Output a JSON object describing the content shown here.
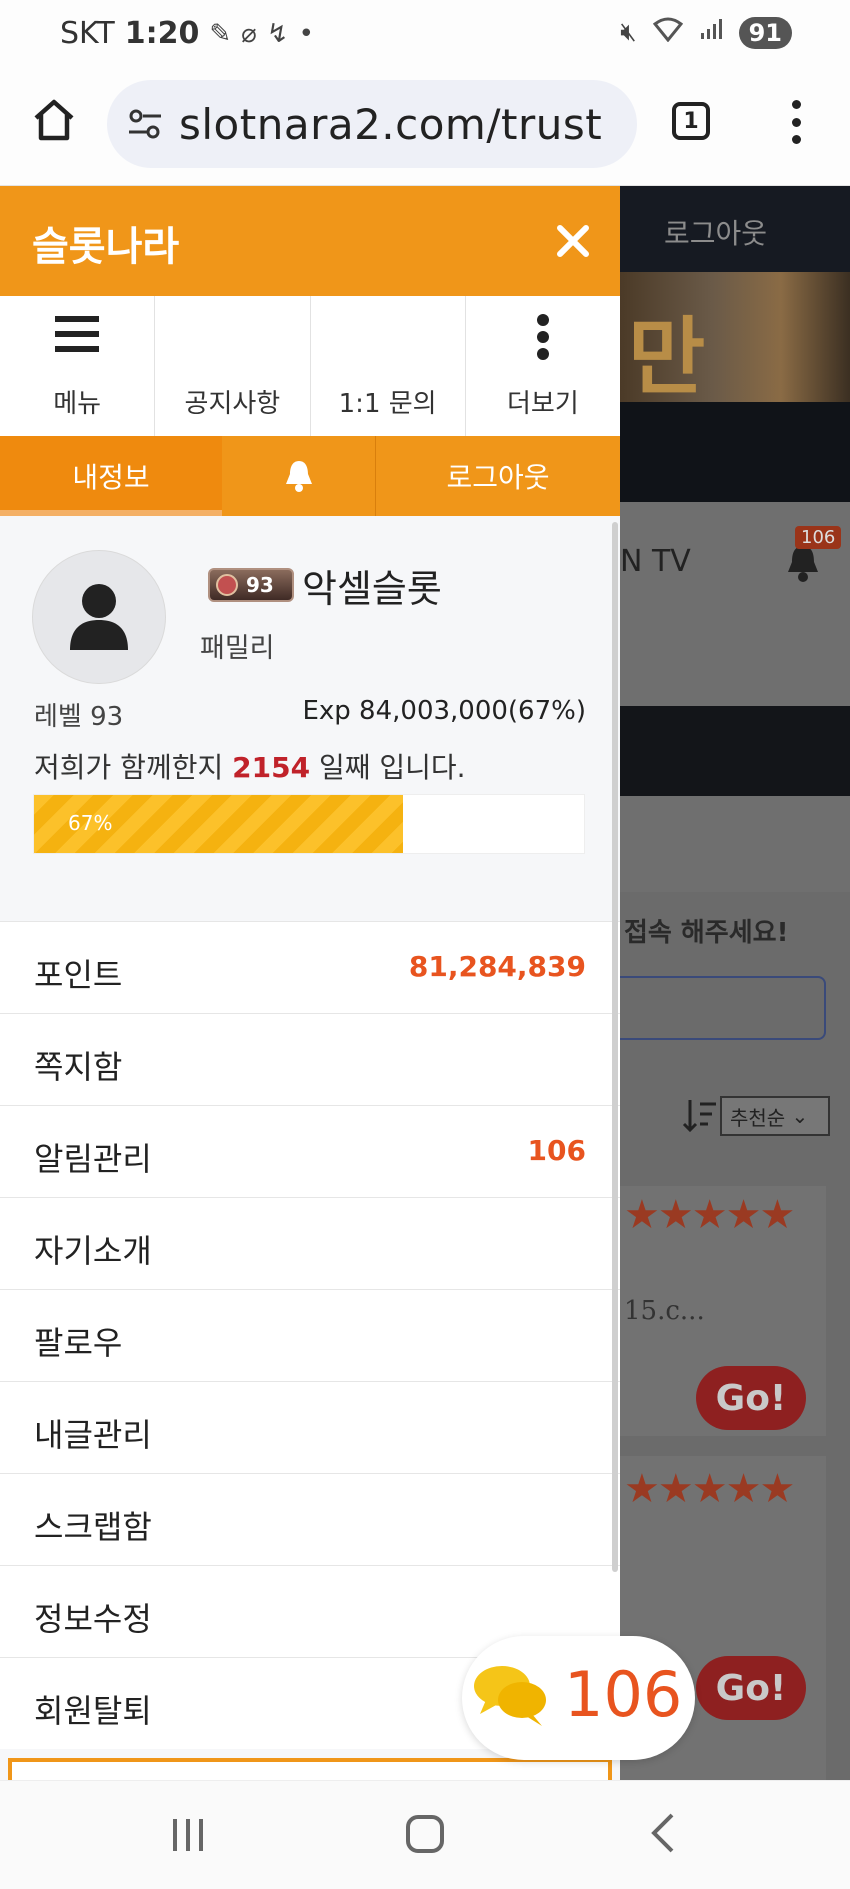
{
  "status_bar": {
    "carrier": "SKT",
    "time": "1:20",
    "battery": "91"
  },
  "browser": {
    "url": "slotnara2.com/trust",
    "tab_count": "1"
  },
  "drawer": {
    "site_title": "슬롯나라",
    "quick_links": [
      {
        "label": "메뉴",
        "icon": "hamburger-icon"
      },
      {
        "label": "공지사항",
        "icon": "none"
      },
      {
        "label": "1:1 문의",
        "icon": "none"
      },
      {
        "label": "더보기",
        "icon": "vertical-dots-icon"
      }
    ],
    "tabs": {
      "my_info": "내정보",
      "logout": "로그아웃"
    },
    "profile": {
      "level_badge": "93",
      "nickname": "악셀슬롯",
      "grade": "패밀리",
      "level_text": "레벨 93",
      "exp_text": "Exp 84,003,000(67%)",
      "days_prefix": "저희가 함께한지",
      "days_value": "2154",
      "days_suffix": "일째 입니다.",
      "progress_label": "67%",
      "progress_fraction": 0.67
    },
    "menu": [
      {
        "label": "포인트",
        "value": "81,284,839"
      },
      {
        "label": "쪽지함",
        "value": ""
      },
      {
        "label": "알림관리",
        "value": "106"
      },
      {
        "label": "자기소개",
        "value": ""
      },
      {
        "label": "팔로우",
        "value": ""
      },
      {
        "label": "내글관리",
        "value": ""
      },
      {
        "label": "스크랩함",
        "value": ""
      },
      {
        "label": "정보수정",
        "value": ""
      },
      {
        "label": "회원탈퇴",
        "value": ""
      }
    ]
  },
  "background_page": {
    "logout": "로그아웃",
    "banner_char": "만",
    "tv_label": "N TV",
    "bell_badge": "106",
    "notice_text": "접속 해주세요!",
    "sort_option": "추천순",
    "card_text": "15.c...",
    "go_label": "Go!"
  },
  "chat": {
    "count": "106"
  },
  "colors": {
    "brand_orange": "#f09619",
    "point_red": "#e8541f",
    "days_red": "#c0222a",
    "progress_yellow": "#fcc12a"
  }
}
